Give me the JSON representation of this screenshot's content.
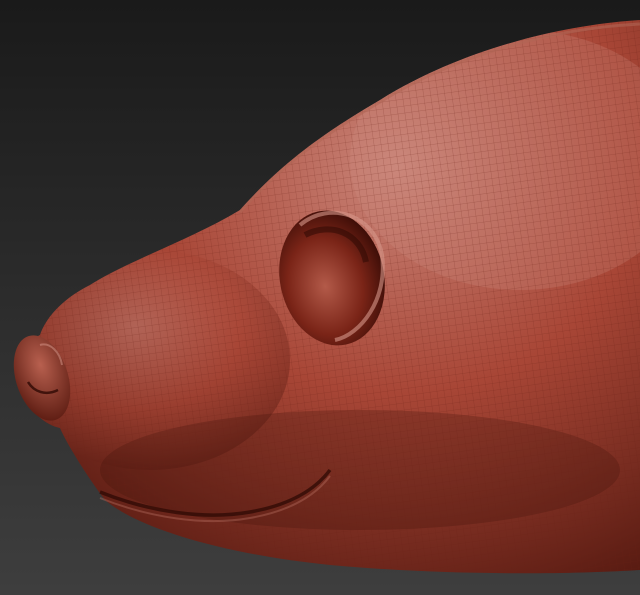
{
  "scene": {
    "background_top": "#1a1a1a",
    "background_bottom": "#3e3e3e",
    "clay_highlight": "#c98478",
    "clay_mid": "#a84636",
    "clay_dark": "#4a130b",
    "wireframe_color": "#6a1f14"
  }
}
